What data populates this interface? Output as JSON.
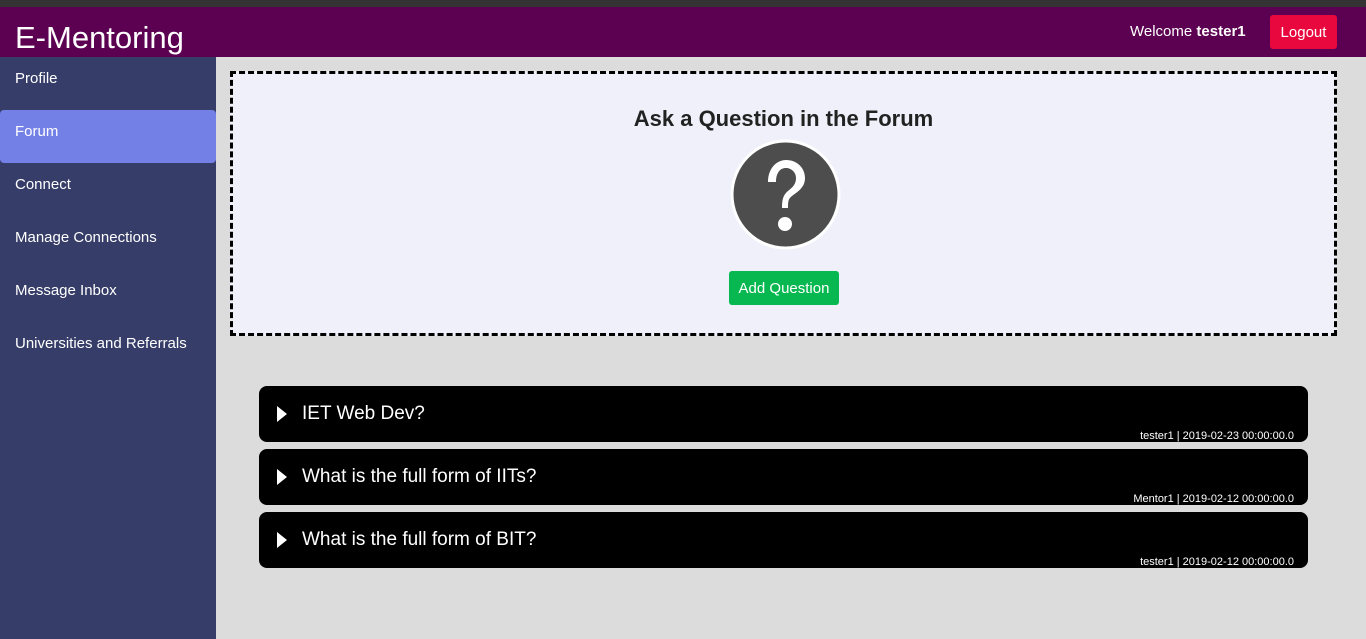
{
  "header": {
    "brand": "E-Mentoring",
    "welcome_prefix": "Welcome ",
    "username": "tester1",
    "logout_label": "Logout",
    "bg_color": "#5c0052",
    "logout_color": "#e8083e"
  },
  "sidebar": {
    "bg_color": "#363d68",
    "active_color": "#7380e6",
    "items": [
      {
        "label": "Profile",
        "active": false
      },
      {
        "label": "Forum",
        "active": true
      },
      {
        "label": "Connect",
        "active": false
      },
      {
        "label": "Manage Connections",
        "active": false
      },
      {
        "label": "Message Inbox",
        "active": false
      },
      {
        "label": "Universities and Referrals",
        "active": false
      }
    ]
  },
  "ask": {
    "title": "Ask a Question in the Forum",
    "icon": "question-mark-icon",
    "button_label": "Add Question",
    "button_color": "#06b84f"
  },
  "questions": [
    {
      "title": "IET Web Dev?",
      "meta": "tester1 | 2019-02-23 00:00:00.0"
    },
    {
      "title": "What is the full form of IITs?",
      "meta": "Mentor1 | 2019-02-12 00:00:00.0"
    },
    {
      "title": "What is the full form of BIT?",
      "meta": "tester1 | 2019-02-12 00:00:00.0"
    }
  ]
}
